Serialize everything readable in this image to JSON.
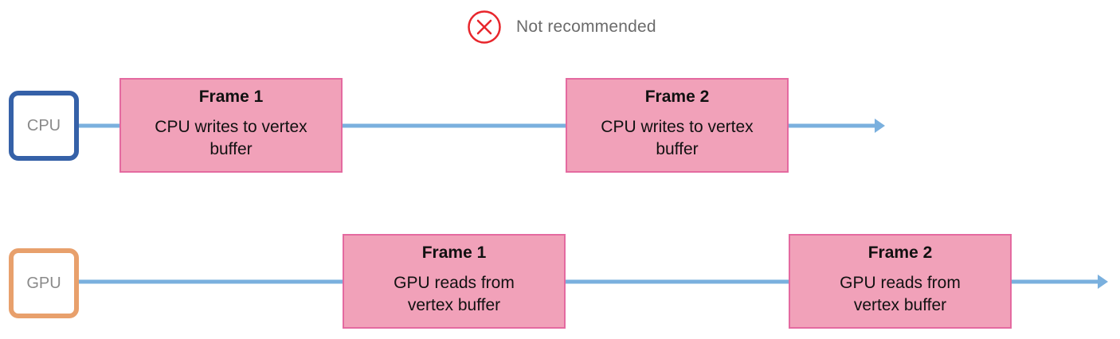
{
  "header": {
    "icon": "x-circle-icon",
    "label": "Not recommended",
    "icon_color": "#e8262c"
  },
  "lanes": {
    "cpu": {
      "label": "CPU",
      "border_color": "#3561a8",
      "frames": [
        {
          "title": "Frame 1",
          "description": "CPU writes to vertex buffer"
        },
        {
          "title": "Frame 2",
          "description": "CPU writes to vertex buffer"
        }
      ]
    },
    "gpu": {
      "label": "GPU",
      "border_color": "#e8a06c",
      "frames": [
        {
          "title": "Frame 1",
          "description": "GPU reads from vertex buffer"
        },
        {
          "title": "Frame 2",
          "description": "GPU reads from vertex buffer"
        }
      ]
    }
  },
  "colors": {
    "timeline": "#7ab0de",
    "frame_fill": "#f1a1b9",
    "frame_border": "#e46aa0"
  }
}
